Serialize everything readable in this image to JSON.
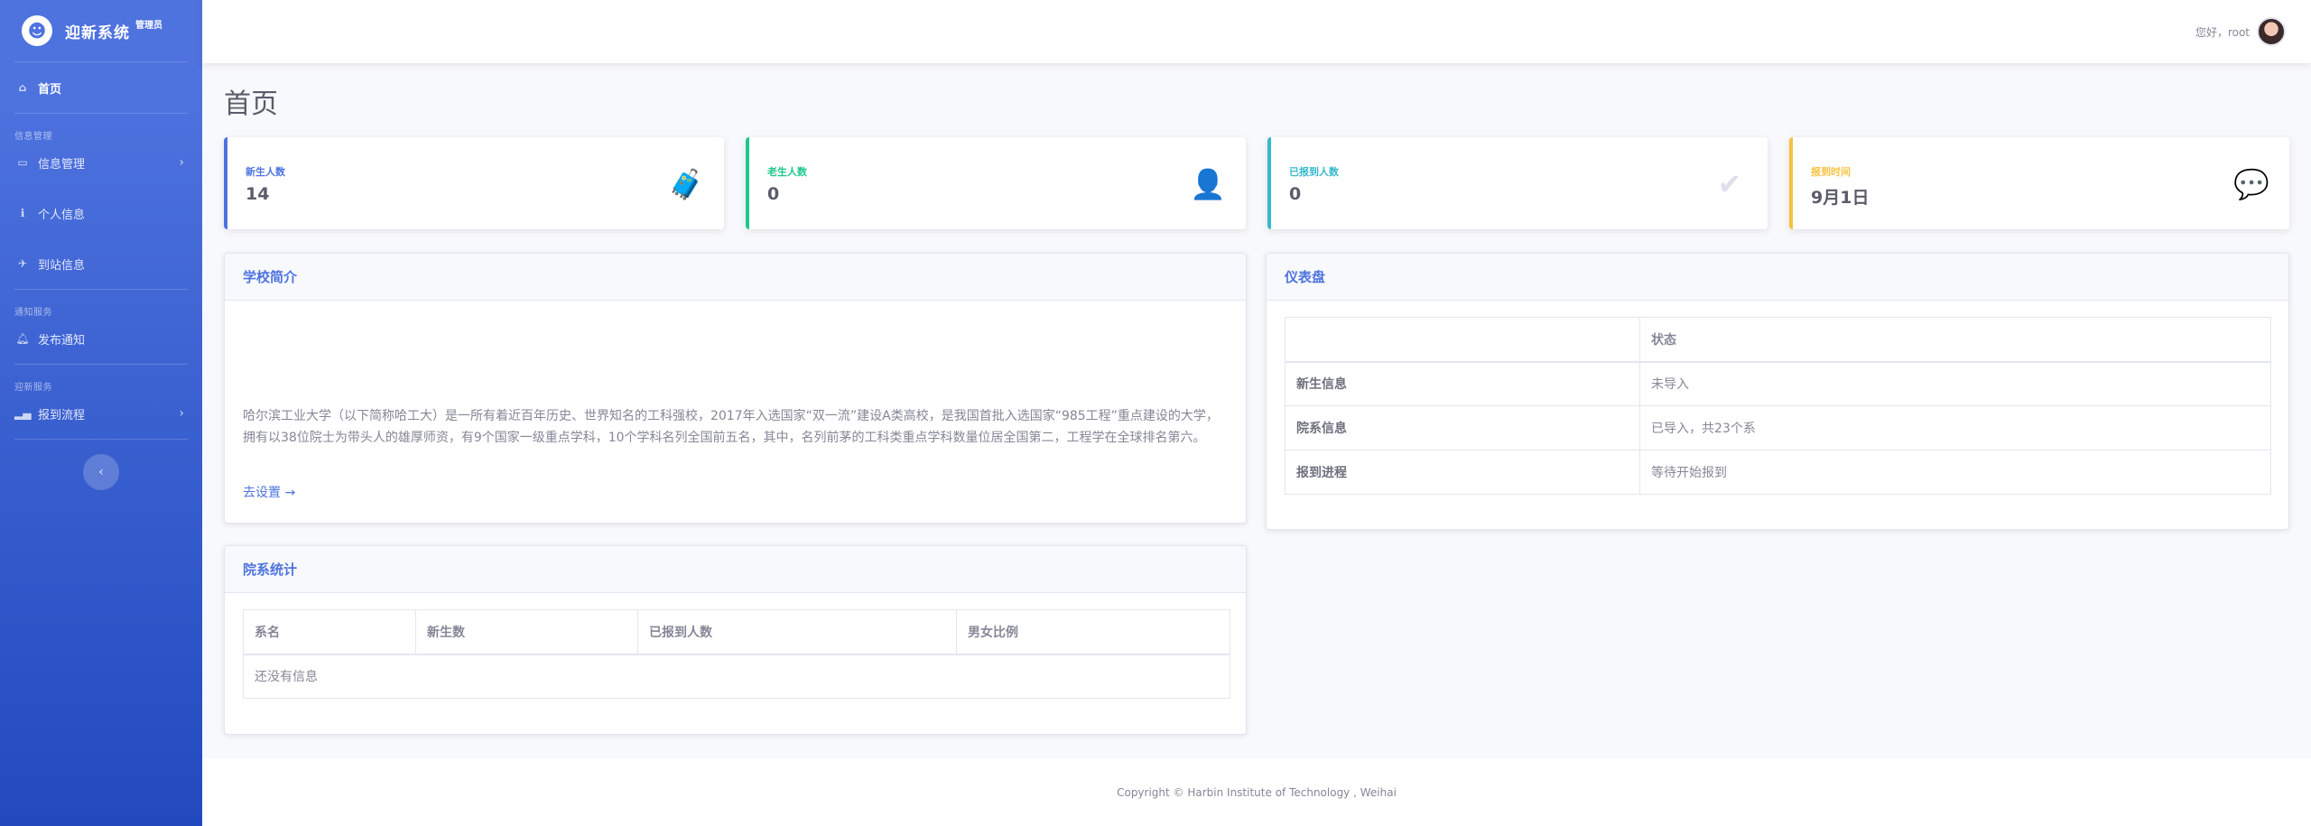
{
  "brand": {
    "logo": "☻",
    "title": "迎新系统",
    "sup": "管理员"
  },
  "sidebar": {
    "home": {
      "icon": "home-icon",
      "label": "首页"
    },
    "section_info": "信息管理",
    "info_manage": {
      "icon": "laptop-icon",
      "label": "信息管理"
    },
    "personal": {
      "icon": "info-icon",
      "label": "个人信息"
    },
    "arrival": {
      "icon": "plane-icon",
      "label": "到站信息"
    },
    "section_notice": "通知服务",
    "publish": {
      "icon": "bell-icon",
      "label": "发布通知"
    },
    "section_welcome": "迎新服务",
    "process": {
      "icon": "signal-icon",
      "label": "报到流程"
    },
    "toggle": "‹"
  },
  "topbar": {
    "greeting": "您好，root"
  },
  "page_title": "首页",
  "stats": [
    {
      "label": "新生人数",
      "value": "14",
      "color": "#4e73df",
      "icon": "luggage-icon",
      "glyph": "🧳"
    },
    {
      "label": "老生人数",
      "value": "0",
      "color": "#1cc88a",
      "icon": "user-check-icon",
      "glyph": "👤"
    },
    {
      "label": "已报到人数",
      "value": "0",
      "color": "#36b9cc",
      "icon": "check-circle-icon",
      "glyph": "✔"
    },
    {
      "label": "报到时间",
      "value": "9月1日",
      "color": "#f6c23e",
      "icon": "comments-icon",
      "glyph": "💬"
    }
  ],
  "intro": {
    "title": "学校简介",
    "text": "哈尔滨工业大学（以下简称哈工大）是一所有着近百年历史、世界知名的工科强校，2017年入选国家“双一流”建设A类高校，是我国首批入选国家“985工程”重点建设的大学，拥有以38位院士为带头人的雄厚师资，有9个国家一级重点学科，10个学科名列全国前五名，其中，名列前茅的工科类重点学科数量位居全国第二，工程学在全球排名第六。",
    "link": "去设置 →"
  },
  "dashboard": {
    "title": "仪表盘",
    "header": [
      "",
      "状态"
    ],
    "rows": [
      [
        "新生信息",
        "未导入"
      ],
      [
        "院系信息",
        "已导入，共23个系"
      ],
      [
        "报到进程",
        "等待开始报到"
      ]
    ]
  },
  "departments": {
    "title": "院系统计",
    "columns": [
      "系名",
      "新生数",
      "已报到人数",
      "男女比例"
    ],
    "empty": "还没有信息"
  },
  "footer": "Copyright © Harbin Institute of Technology , Weihai"
}
